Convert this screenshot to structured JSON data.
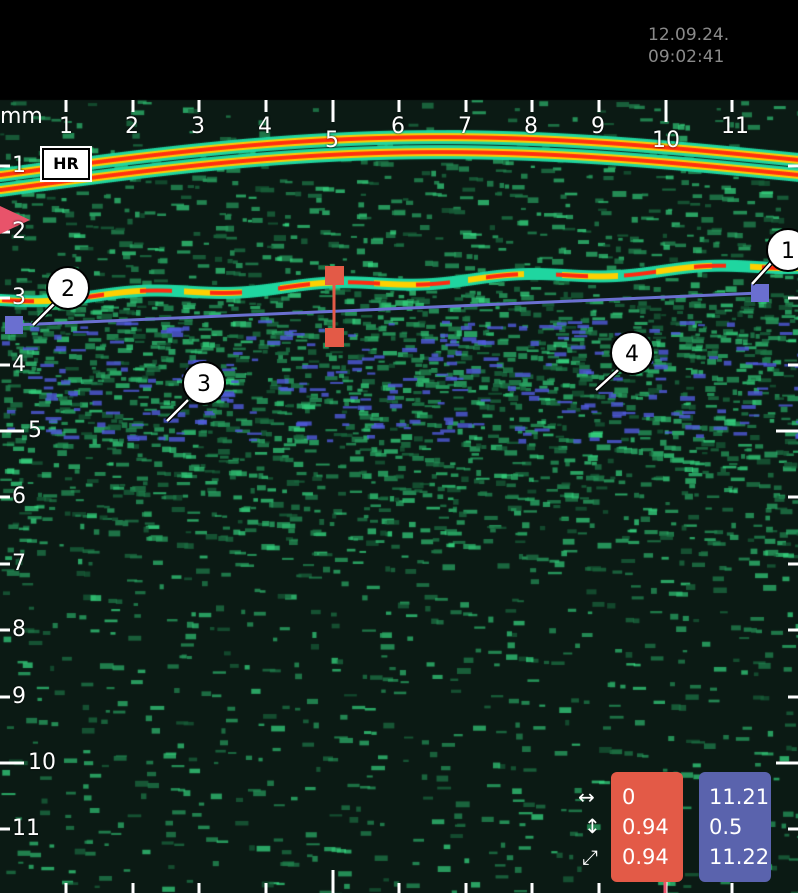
{
  "datetime": {
    "date": "12.09.24.",
    "time": "09:02:41"
  },
  "axes": {
    "unit": "mm",
    "x_ticks": [
      "1",
      "2",
      "3",
      "4",
      "5",
      "6",
      "7",
      "8",
      "9",
      "10",
      "11"
    ],
    "y_ticks": [
      "1",
      "2",
      "3",
      "4",
      "5",
      "6",
      "7",
      "8",
      "9",
      "10",
      "11"
    ]
  },
  "badge": {
    "label": "HR"
  },
  "markers": [
    "1",
    "2",
    "3",
    "4"
  ],
  "measurements": {
    "icons": [
      "horizontal-arrow-icon",
      "vertical-arrow-icon",
      "diagonal-arrow-icon"
    ],
    "red": {
      "horizontal": "0",
      "vertical": "0.94",
      "diagonal": "0.94",
      "color": "#e35a47"
    },
    "blue": {
      "horizontal": "11.21",
      "vertical": "0.5",
      "diagonal": "11.22",
      "color": "#5a63ad"
    }
  }
}
